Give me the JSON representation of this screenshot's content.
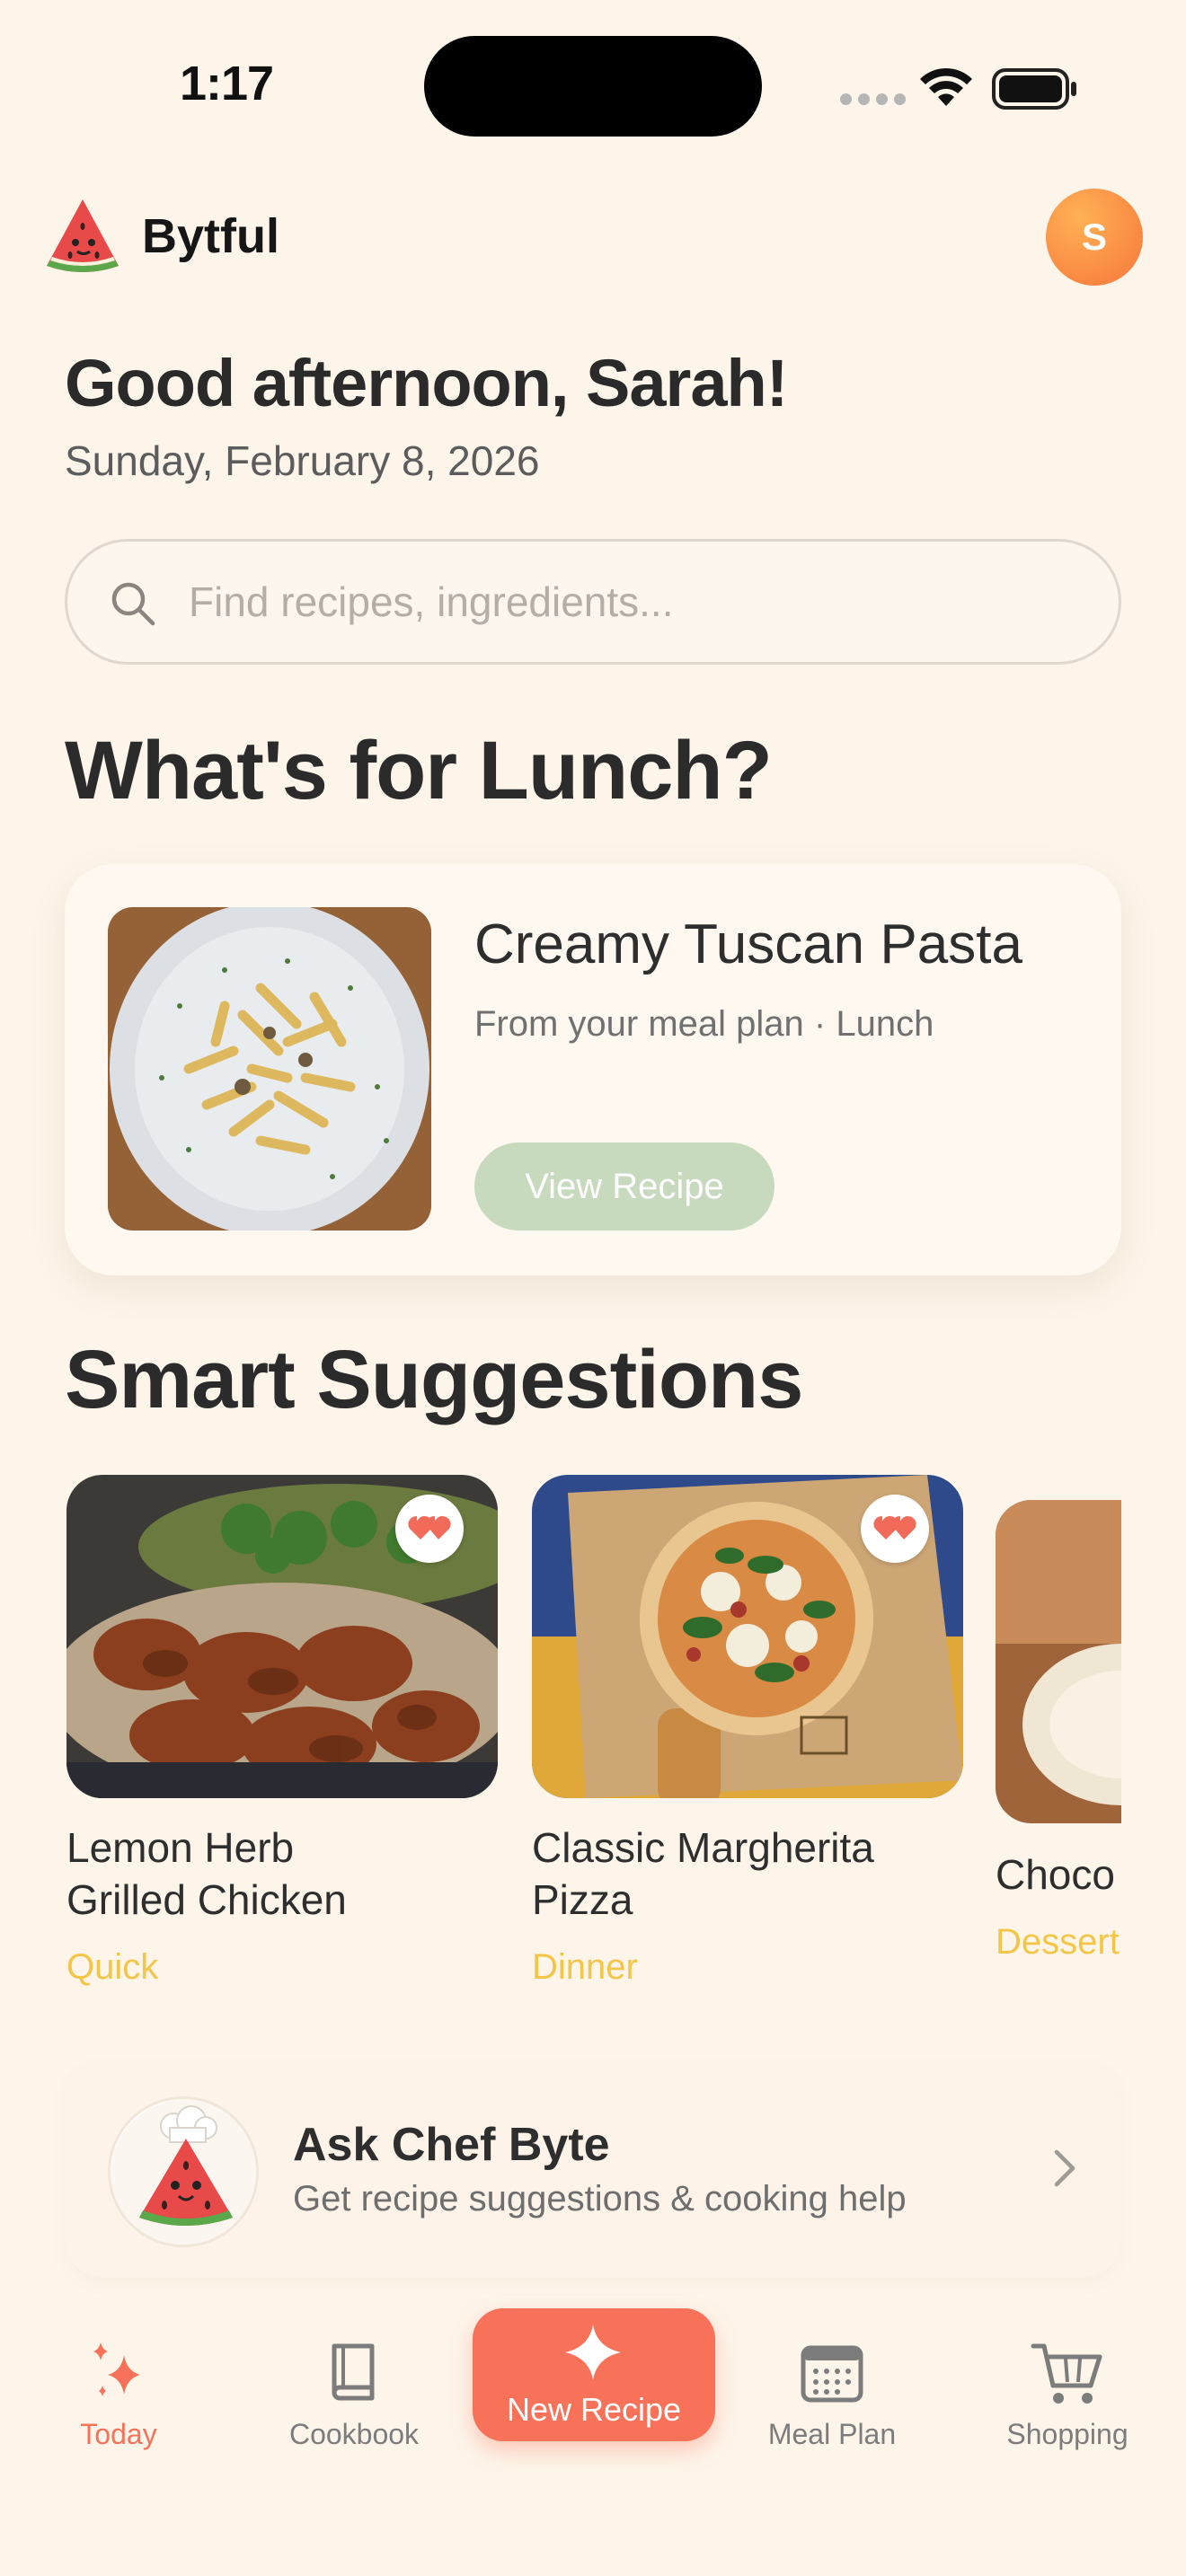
{
  "status_bar": {
    "time": "1:17"
  },
  "header": {
    "app_name": "Bytful",
    "avatar_initial": "S"
  },
  "greeting": {
    "title": "Good afternoon, Sarah!",
    "date": "Sunday, February 8, 2026"
  },
  "search": {
    "placeholder": "Find recipes, ingredients...",
    "value": ""
  },
  "lunch": {
    "section_title": "What's for Lunch?",
    "recipe_title": "Creamy Tuscan Pasta",
    "subtitle": "From your meal plan · Lunch",
    "button_label": "View Recipe"
  },
  "suggestions": {
    "section_title": "Smart Suggestions",
    "items": [
      {
        "name_line1": "Lemon Herb",
        "name_line2": "Grilled Chicken",
        "tag": "Quick",
        "favorited": true
      },
      {
        "name_line1": "Classic Margherita",
        "name_line2": "Pizza",
        "tag": "Dinner",
        "favorited": true
      },
      {
        "name_line1": "Choco",
        "name_line2": "",
        "tag": "Dessert",
        "favorited": false
      }
    ]
  },
  "chef": {
    "title": "Ask Chef Byte",
    "subtitle": "Get recipe suggestions & cooking help"
  },
  "nav": {
    "today": "Today",
    "cookbook": "Cookbook",
    "new_recipe": "New Recipe",
    "meal_plan": "Meal Plan",
    "shopping": "Shopping"
  },
  "colors": {
    "background": "#FDF5EA",
    "accent": "#F87259",
    "tag": "#F3C64A",
    "view_button": "#C7DABE",
    "avatar": "#F98842"
  }
}
